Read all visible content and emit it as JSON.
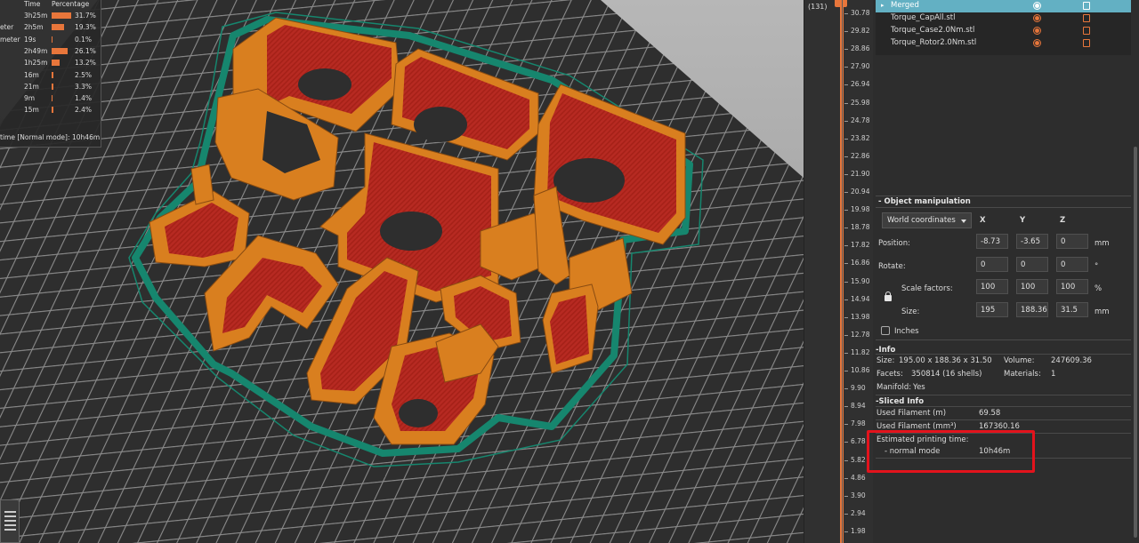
{
  "stats": {
    "headers": {
      "time": "Time",
      "percentage": "Percentage"
    },
    "rows": [
      {
        "label": "",
        "time": "3h25m",
        "pct": "31.7%",
        "frac": 0.317
      },
      {
        "label": "eter",
        "time": "2h5m",
        "pct": "19.3%",
        "frac": 0.193
      },
      {
        "label": "meter",
        "time": "19s",
        "pct": "0.1%",
        "frac": 0.001
      },
      {
        "label": "",
        "time": "2h49m",
        "pct": "26.1%",
        "frac": 0.261
      },
      {
        "label": "",
        "time": "1h25m",
        "pct": "13.2%",
        "frac": 0.132
      },
      {
        "label": "",
        "time": "16m",
        "pct": "2.5%",
        "frac": 0.025
      },
      {
        "label": "",
        "time": "21m",
        "pct": "3.3%",
        "frac": 0.033
      },
      {
        "label": "",
        "time": "9m",
        "pct": "1.4%",
        "frac": 0.014
      },
      {
        "label": "",
        "time": "15m",
        "pct": "2.4%",
        "frac": 0.024
      }
    ],
    "footer_label": "time [Normal mode]:",
    "footer_value": "10h46m"
  },
  "slider": {
    "top_value": "(131)",
    "ticks": [
      "30.78",
      "29.82",
      "28.86",
      "27.90",
      "26.94",
      "25.98",
      "24.78",
      "23.82",
      "22.86",
      "21.90",
      "20.94",
      "19.98",
      "18.78",
      "17.82",
      "16.86",
      "15.90",
      "14.94",
      "13.98",
      "12.78",
      "11.82",
      "10.86",
      "9.90",
      "8.94",
      "7.98",
      "6.78",
      "5.82",
      "4.86",
      "3.90",
      "2.94",
      "1.98"
    ]
  },
  "objects": [
    {
      "name": "Merged",
      "selected": true
    },
    {
      "name": "Torque_CapAll.stl",
      "selected": false
    },
    {
      "name": "Torque_Case2.0Nm.stl",
      "selected": false
    },
    {
      "name": "Torque_Rotor2.0Nm.stl",
      "selected": false
    }
  ],
  "manipulation": {
    "title": "Object manipulation",
    "coord_system": "World coordinates",
    "axes": [
      "X",
      "Y",
      "Z"
    ],
    "position": {
      "label": "Position:",
      "values": [
        "-8.73",
        "-3.65",
        "0"
      ],
      "unit": "mm"
    },
    "rotate": {
      "label": "Rotate:",
      "values": [
        "0",
        "0",
        "0"
      ],
      "unit": "°"
    },
    "scale": {
      "label": "Scale factors:",
      "values": [
        "100",
        "100",
        "100"
      ],
      "unit": "%"
    },
    "size": {
      "label": "Size:",
      "values": [
        "195",
        "188.36",
        "31.5"
      ],
      "unit": "mm"
    },
    "inches_label": "Inches"
  },
  "info": {
    "title": "Info",
    "size_label": "Size:",
    "size_value": "195.00 x 188.36 x 31.50",
    "volume_label": "Volume:",
    "volume_value": "247609.36",
    "facets_label": "Facets:",
    "facets_value": "350814 (16 shells)",
    "materials_label": "Materials:",
    "materials_value": "1",
    "manifold_label": "Manifold:",
    "manifold_value": "Yes"
  },
  "sliced": {
    "title": "Sliced Info",
    "filament_m_label": "Used Filament (m)",
    "filament_m_value": "69.58",
    "filament_mm3_label": "Used Filament (mm³)",
    "filament_mm3_value": "167360.16",
    "time_label": "Estimated printing time:",
    "mode_label": "- normal mode",
    "mode_value": "10h46m"
  },
  "colors": {
    "accent": "#e8763b",
    "selection": "#63b0c3",
    "highlight": "#e3131c",
    "infill": "#b72a22",
    "perimeter": "#d97f1f",
    "skirt": "#16866e"
  }
}
